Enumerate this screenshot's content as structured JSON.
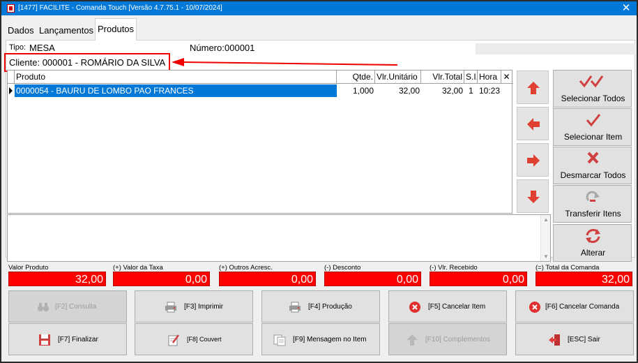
{
  "window": {
    "title": "[1477] FACILITE - Comanda Touch [Versão 4.7.75.1 - 10/07/2024]",
    "close_glyph": "✕"
  },
  "tabs": [
    {
      "label": "Dados"
    },
    {
      "label": "Lançamentos"
    },
    {
      "label": "Produtos",
      "active": true
    }
  ],
  "info": {
    "tipo_label": "Tipo:",
    "tipo_value": "MESA",
    "numero_label": "Número:",
    "numero_value": "000001",
    "cliente": "Cliente: 000001 - ROMÁRIO DA SILVA"
  },
  "grid": {
    "columns": [
      "Produto",
      "Qtde.",
      "Vlr.Unitário",
      "Vlr.Total",
      "S.I.",
      "Hora",
      "✕"
    ],
    "rows": [
      {
        "produto": "0000054 - BAURU DE LOMBO PAO FRANCES",
        "qtde": "1,000",
        "unitario": "32,00",
        "total": "32,00",
        "si": "1",
        "hora": "10:23"
      }
    ]
  },
  "nav_buttons": [
    {
      "icon": "arrow-up-icon"
    },
    {
      "icon": "arrow-left-icon"
    },
    {
      "icon": "arrow-right-icon"
    },
    {
      "icon": "arrow-down-icon"
    }
  ],
  "actions": [
    {
      "label": "Selecionar Todos",
      "icon": "double-check-icon"
    },
    {
      "label": "Selecionar Item",
      "icon": "check-icon"
    },
    {
      "label": "Desmarcar Todos",
      "icon": "x-mark-icon"
    },
    {
      "label": "Transferir Itens",
      "icon": "transfer-icon"
    },
    {
      "label": "Alterar",
      "icon": "refresh-icon"
    }
  ],
  "totals": [
    {
      "label": "Valor Produto",
      "value": "32,00"
    },
    {
      "label": "(+) Valor da Taxa",
      "value": "0,00"
    },
    {
      "label": "(+) Outros Acresc.",
      "value": "0,00"
    },
    {
      "label": "(-) Desconto",
      "value": "0,00"
    },
    {
      "label": "(-) Vlr. Recebido",
      "value": "0,00"
    },
    {
      "label": "(=) Total da Comanda",
      "value": "32,00"
    }
  ],
  "function_buttons": [
    {
      "label": "[F2] Consulta",
      "icon": "binoculars-icon",
      "enabled": false
    },
    {
      "label": "[F3] Imprimir",
      "icon": "printer-icon",
      "enabled": true
    },
    {
      "label": "[F4] Produção",
      "icon": "printer-icon",
      "enabled": true
    },
    {
      "label": "[F5] Cancelar Item",
      "icon": "cancel-icon",
      "enabled": true
    },
    {
      "label": "[F6] Cancelar Comanda",
      "icon": "cancel-icon",
      "enabled": true
    },
    {
      "label": "[F7] Finalizar",
      "icon": "save-icon",
      "enabled": true
    },
    {
      "label": "[F8] Couvert",
      "icon": "pencil-icon",
      "enabled": true
    },
    {
      "label": "[F9] Mensagem no Item",
      "icon": "message-icon",
      "enabled": true
    },
    {
      "label": "[F10] Complementos",
      "icon": "up-arrow-icon",
      "enabled": false
    },
    {
      "label": "[ESC] Sair",
      "icon": "exit-icon",
      "enabled": true
    }
  ],
  "colors": {
    "titlebar": "#0078d7",
    "selection": "#0078d7",
    "total_box": "#ff0000",
    "accent_red": "#e02020",
    "annotation": "#e00000"
  }
}
